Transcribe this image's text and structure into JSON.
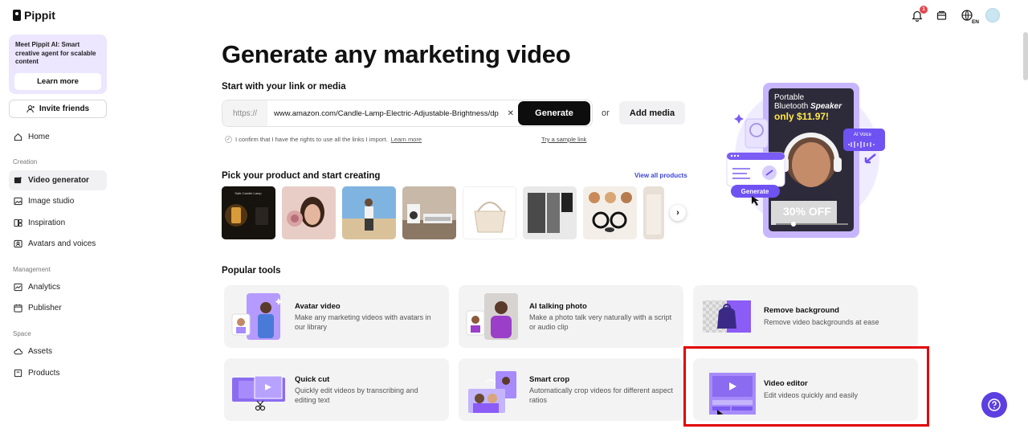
{
  "app": {
    "name": "Pippit"
  },
  "sidebar": {
    "promo": {
      "text": "Meet Pippit AI: Smart creative agent for scalable content",
      "button": "Learn more"
    },
    "invite": "Invite friends",
    "home": "Home",
    "sections": {
      "creation": "Creation",
      "management": "Management",
      "space": "Space"
    },
    "items": {
      "video_generator": "Video generator",
      "image_studio": "Image studio",
      "inspiration": "Inspiration",
      "avatars": "Avatars and voices",
      "analytics": "Analytics",
      "publisher": "Publisher",
      "assets": "Assets",
      "products": "Products"
    }
  },
  "topbar": {
    "notification_count": "1",
    "language": "EN"
  },
  "main": {
    "title": "Generate any marketing video",
    "link_section_title": "Start with your link or media",
    "url_prefix": "https://",
    "url_value": "www.amazon.com/Candle-Lamp-Electric-Adjustable-Brightness/dp",
    "generate_label": "Generate",
    "or_label": "or",
    "add_media_label": "Add media",
    "confirm_text": "I confirm that I have the rights to use all the links I import.",
    "learn_more": "Learn more",
    "try_sample": "Try a sample link",
    "pick_title": "Pick your product and start creating",
    "view_all": "View all products",
    "product_1_caption": "Safe Candle Lamp",
    "popular_title": "Popular tools"
  },
  "hero": {
    "line1": "Portable",
    "line2a": "Bluetooth ",
    "line2b": "Speaker",
    "price": "only $11.97!",
    "ai_voice": "AI Voice",
    "generate": "Generate",
    "discount": "30% OFF"
  },
  "tools": [
    {
      "name": "Avatar video",
      "desc": "Make any marketing videos with avatars in our library"
    },
    {
      "name": "AI talking photo",
      "desc": "Make a photo talk very naturally with a script or audio clip"
    },
    {
      "name": "Remove background",
      "desc": "Remove video backgrounds at ease"
    },
    {
      "name": "Quick cut",
      "desc": "Quickly edit videos by transcribing and editing text"
    },
    {
      "name": "Smart crop",
      "desc": "Automatically crop videos for different aspect ratios"
    },
    {
      "name": "Video editor",
      "desc": "Edit videos quickly and easily"
    }
  ],
  "colors": {
    "accent": "#6c4ff0",
    "highlight": "#e10000",
    "brand_light": "#ece6ff"
  }
}
